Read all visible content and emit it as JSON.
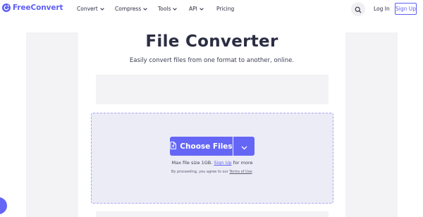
{
  "brand": {
    "name_part1": "Free",
    "name_part2": "Convert"
  },
  "nav": {
    "convert": "Convert",
    "compress": "Compress",
    "tools": "Tools",
    "api": "API",
    "pricing": "Pricing"
  },
  "header_actions": {
    "login": "Log In",
    "signup": "Sign Up"
  },
  "hero": {
    "title": "File Converter",
    "subtitle": "Easily convert files from one format to another, online."
  },
  "upload": {
    "choose_label": "Choose Files",
    "max_size_prefix": "Max file size 1GB.",
    "max_size_link": "Sign Up",
    "max_size_suffix": "for more",
    "terms_prefix": "By proceeding, you agree to our",
    "terms_link": "Terms of Use",
    "terms_suffix": "."
  },
  "colors": {
    "accent": "#5e5ff5",
    "button": "#6566f5",
    "dropzone_bg": "#ececf6",
    "panel_bg": "#f3f3f5"
  },
  "icons": [
    "logo-icon",
    "chevron-down-icon",
    "search-icon",
    "file-icon",
    "chat-icon"
  ]
}
